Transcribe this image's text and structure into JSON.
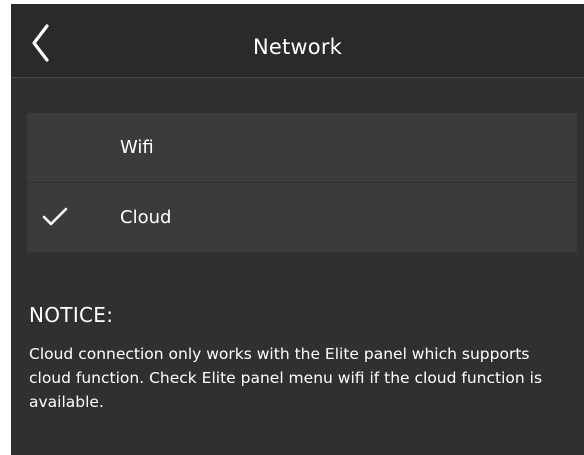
{
  "header": {
    "title": "Network",
    "back_icon": "chevron-left-icon"
  },
  "menu": {
    "items": [
      {
        "label": "Wifi",
        "selected": false
      },
      {
        "label": "Cloud",
        "selected": true
      }
    ],
    "check_icon": "checkmark-icon"
  },
  "notice": {
    "heading": "NOTICE:",
    "body": "Cloud connection only works with the Elite panel which supports cloud function. Check Elite panel menu wifi if the cloud function is available."
  },
  "colors": {
    "background": "#303030",
    "header_background": "#2a2a2a",
    "menu_background": "#3b3b3b",
    "text": "#ffffff"
  }
}
